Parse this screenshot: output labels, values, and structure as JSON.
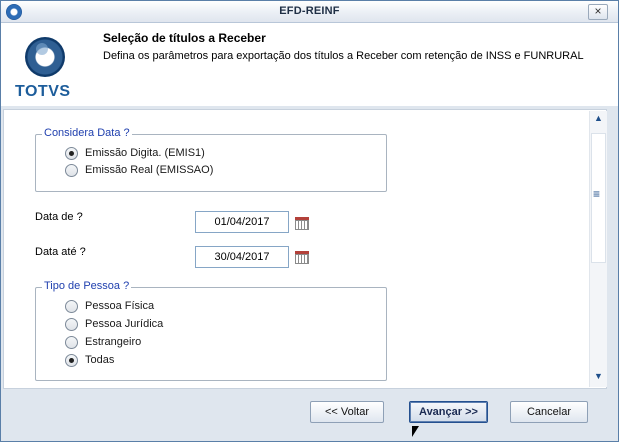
{
  "window": {
    "title": "EFD-REINF",
    "close_label": "×"
  },
  "header": {
    "logo_text": "TOTVS",
    "title": "Seleção de títulos a Receber",
    "subtitle": "Defina os parâmetros para exportação dos títulos a Receber com retenção de INSS e FUNRURAL"
  },
  "considera_data": {
    "legend": "Considera Data ?",
    "options": [
      {
        "label": "Emissão Digita. (EMIS1)",
        "selected": true
      },
      {
        "label": "Emissão Real (EMISSAO)",
        "selected": false
      }
    ]
  },
  "data_de": {
    "label": "Data de ?",
    "value": "01/04/2017"
  },
  "data_ate": {
    "label": "Data até ?",
    "value": "30/04/2017"
  },
  "tipo_pessoa": {
    "legend": "Tipo de Pessoa ?",
    "options": [
      {
        "label": "Pessoa Física",
        "selected": false
      },
      {
        "label": "Pessoa Jurídica",
        "selected": false
      },
      {
        "label": "Estrangeiro",
        "selected": false
      },
      {
        "label": "Todas",
        "selected": true
      }
    ]
  },
  "scrollbar": {
    "up": "▲",
    "down": "▼",
    "grip": "≡"
  },
  "footer": {
    "back_label": "<< Voltar",
    "next_label": "Avançar >>",
    "cancel_label": "Cancelar"
  }
}
